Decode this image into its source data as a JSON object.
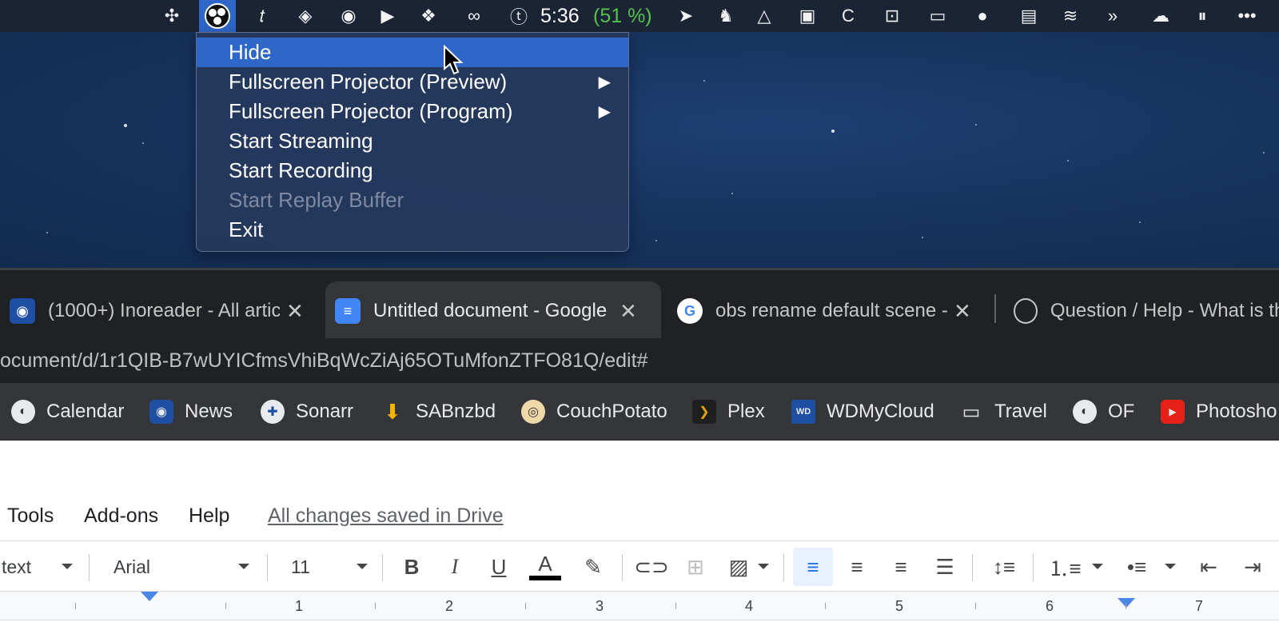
{
  "menubar": {
    "clock": "5:36",
    "battery": "(51 %)",
    "icons": [
      "grid-icon",
      "obs-icon",
      "typora-icon",
      "layers-icon",
      "camera-icon",
      "zoom-icon",
      "dropbox-icon",
      "creative-cloud-icon",
      "typeeto-icon",
      "prompt-icon",
      "evernote-icon",
      "drive-icon",
      "calendar-icon",
      "cleaner-icon",
      "presentation-icon",
      "video-icon",
      "siri-icon",
      "battery-icon",
      "weather-icon",
      "forward-icon",
      "upload-icon",
      "pause-icon",
      "more-icon"
    ],
    "accent": "#2f67c8"
  },
  "context_menu": {
    "items": [
      {
        "label": "Hide",
        "highlighted": true,
        "disabled": false,
        "submenu": false
      },
      {
        "label": "Fullscreen Projector (Preview)",
        "highlighted": false,
        "disabled": false,
        "submenu": true
      },
      {
        "label": "Fullscreen Projector (Program)",
        "highlighted": false,
        "disabled": false,
        "submenu": true
      },
      {
        "label": "Start Streaming",
        "highlighted": false,
        "disabled": false,
        "submenu": false
      },
      {
        "label": "Start Recording",
        "highlighted": false,
        "disabled": false,
        "submenu": false
      },
      {
        "label": "Start Replay Buffer",
        "highlighted": false,
        "disabled": true,
        "submenu": false
      },
      {
        "label": "Exit",
        "highlighted": false,
        "disabled": false,
        "submenu": false
      }
    ],
    "submenu_arrow": "▶"
  },
  "tabs": [
    {
      "title": "(1000+) Inoreader - All artic",
      "close": "✕"
    },
    {
      "title": "Untitled document - Google",
      "close": "✕"
    },
    {
      "title": "obs rename default scene -",
      "close": "✕"
    },
    {
      "title": "Question / Help - What is th"
    }
  ],
  "address": {
    "url": "ocument/d/1r1QIB-B7wUYICfmsVhiBqWcZiAj65OTuMfonZTFO81Q/edit#"
  },
  "bookmarks": [
    {
      "label": "Calendar",
      "icon": "globe-icon"
    },
    {
      "label": "News",
      "icon": "rss-icon"
    },
    {
      "label": "Sonarr",
      "icon": "sonarr-icon"
    },
    {
      "label": "SABnzbd",
      "icon": "download-icon"
    },
    {
      "label": "CouchPotato",
      "icon": "couchpotato-icon"
    },
    {
      "label": "Plex",
      "icon": "plex-icon"
    },
    {
      "label": "WDMyCloud",
      "icon": "wd-icon"
    },
    {
      "label": "Travel",
      "icon": "folder-icon"
    },
    {
      "label": "OF",
      "icon": "globe-icon"
    },
    {
      "label": "Photosho",
      "icon": "youtube-icon"
    }
  ],
  "docs": {
    "menu": [
      "Tools",
      "Add-ons",
      "Help"
    ],
    "saved_status": "All changes saved in Drive",
    "style_value": "text",
    "font_value": "Arial",
    "size_value": "11",
    "toolbar": {
      "bold": "B",
      "italic": "I",
      "underline": "U",
      "text_color": "A"
    },
    "ruler_numbers": [
      "1",
      "2",
      "3",
      "4",
      "5",
      "6",
      "7"
    ]
  }
}
